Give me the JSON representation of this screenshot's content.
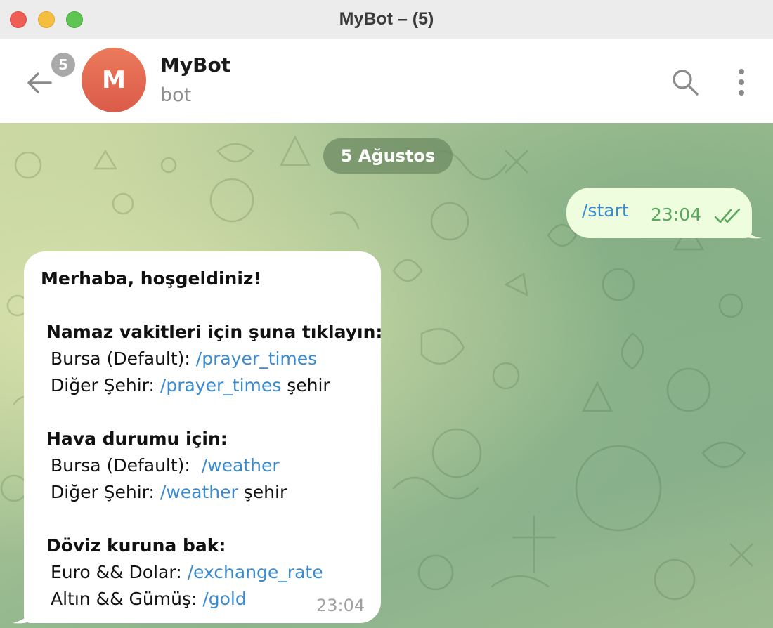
{
  "window": {
    "title": "MyBot – (5)"
  },
  "header": {
    "unread_count": "5",
    "avatar_letter": "M",
    "chat_name": "MyBot",
    "chat_subtitle": "bot",
    "avatar_color": "#e06a52"
  },
  "chat": {
    "date_label": "5 Ağustos",
    "outgoing": {
      "text": "/start",
      "time": "23:04"
    },
    "incoming": {
      "greeting": "Merhaba, hoşgeldiniz!",
      "prayer_heading": "Namaz vakitleri için şuna tıklayın:",
      "prayer_default_label": "Bursa (Default): ",
      "prayer_default_cmd": "/prayer_times",
      "prayer_other_label": "Diğer Şehir: ",
      "prayer_other_cmd": "/prayer_times",
      "prayer_other_suffix": " şehir",
      "weather_heading": "Hava durumu için:",
      "weather_default_label": "Bursa (Default):  ",
      "weather_default_cmd": "/weather",
      "weather_other_label": "Diğer Şehir: ",
      "weather_other_cmd": "/weather",
      "weather_other_suffix": " şehir",
      "exchange_heading": "Döviz kuruna bak:",
      "exchange_label": "Euro && Dolar: ",
      "exchange_cmd": "/exchange_rate",
      "gold_label": "Altın && Gümüş: ",
      "gold_cmd": "/gold",
      "time": "23:04"
    },
    "link_color": "#3a8ad0",
    "outgoing_bubble_color": "#eefdde"
  }
}
